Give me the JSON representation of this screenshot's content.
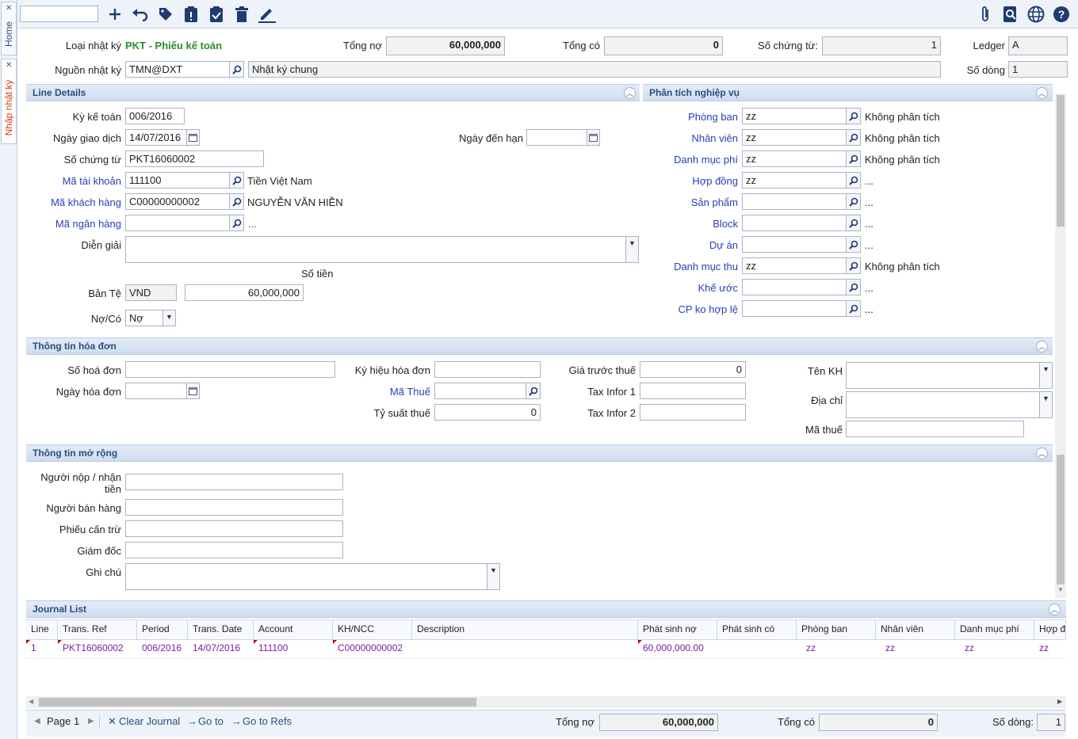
{
  "side_tabs": {
    "home": "Home",
    "journal_entry": "Nhập nhật ký"
  },
  "header": {
    "journal_type_label": "Loại nhật ký",
    "journal_type_value": "PKT - Phiếu kế toán",
    "total_debit_label": "Tổng nợ",
    "total_debit_value": "60,000,000",
    "total_credit_label": "Tổng có",
    "total_credit_value": "0",
    "voucher_no_label": "Số chứng từ:",
    "voucher_no_value": "1",
    "ledger_label": "Ledger",
    "ledger_value": "A",
    "source_label": "Nguồn nhật ký",
    "source_value": "TMN@DXT",
    "source_desc": "Nhật ký chung",
    "line_count_label": "Số dòng",
    "line_count_value": "1"
  },
  "line_details": {
    "title": "Line Details",
    "period_label": "Kỳ kế toán",
    "period_value": "006/2016",
    "trans_date_label": "Ngày giao dịch",
    "trans_date_value": "14/07/2016",
    "due_date_label": "Ngày đến hạn",
    "due_date_value": "",
    "voucher_label": "Số chứng từ",
    "voucher_value": "PKT16060002",
    "account_label": "Mã tài khoản",
    "account_value": "111100",
    "account_desc": "Tiền Việt Nam",
    "customer_label": "Mã khách hàng",
    "customer_value": "C00000000002",
    "customer_desc": "NGUYỄN VĂN HIỀN",
    "bank_label": "Mã ngân hàng",
    "bank_value": "",
    "bank_desc": "...",
    "description_label": "Diễn giải",
    "description_value": "",
    "amount_header": "Số tiền",
    "base_currency_label": "Bản Tệ",
    "currency_value": "VND",
    "amount_value": "60,000,000",
    "dc_label": "Nợ/Có",
    "dc_value": "Nợ"
  },
  "analysis": {
    "title": "Phân tích nghiệp vụ",
    "rows": [
      {
        "label": "Phòng ban",
        "value": "zz",
        "desc": "Không phân tích"
      },
      {
        "label": "Nhân viên",
        "value": "zz",
        "desc": "Không phân tích"
      },
      {
        "label": "Danh mục phí",
        "value": "zz",
        "desc": "Không phân tích"
      },
      {
        "label": "Hợp đồng",
        "value": "zz",
        "desc": "..."
      },
      {
        "label": "Sản phẩm",
        "value": "",
        "desc": "..."
      },
      {
        "label": "Block",
        "value": "",
        "desc": "..."
      },
      {
        "label": "Dự án",
        "value": "",
        "desc": "..."
      },
      {
        "label": "Danh mục thu",
        "value": "zz",
        "desc": "Không phân tích"
      },
      {
        "label": "Khế ước",
        "value": "",
        "desc": "..."
      },
      {
        "label": "CP ko hợp lệ",
        "value": "",
        "desc": "..."
      }
    ]
  },
  "invoice": {
    "title": "Thông tin hóa đơn",
    "invoice_no_label": "Số hoá đơn",
    "invoice_no_value": "",
    "invoice_date_label": "Ngày hóa đơn",
    "invoice_date_value": "",
    "symbol_label": "Ký hiệu hóa đơn",
    "symbol_value": "",
    "tax_code_label": "Mã Thuế",
    "tax_code_value": "",
    "tax_rate_label": "Tỷ suất thuế",
    "tax_rate_value": "0",
    "pretax_label": "Giá trước thuế",
    "pretax_value": "0",
    "tax_info1_label": "Tax Infor 1",
    "tax_info1_value": "",
    "tax_info2_label": "Tax Infor 2",
    "tax_info2_value": "",
    "customer_name_label": "Tên KH",
    "customer_name_value": "",
    "address_label": "Địa chỉ",
    "address_value": "",
    "tax_id_label": "Mã thuế",
    "tax_id_value": ""
  },
  "extended": {
    "title": "Thông tin mở rộng",
    "payer_label_1": "Người nộp / nhận",
    "payer_label_2": "tiền",
    "payer_value": "",
    "seller_label": "Người bán hàng",
    "seller_value": "",
    "offset_label": "Phiếu cấn trừ",
    "offset_value": "",
    "director_label": "Giám đốc",
    "director_value": "",
    "note_label": "Ghi chú",
    "note_value": ""
  },
  "journal_list": {
    "title": "Journal List",
    "columns": [
      "Line",
      "Trans. Ref",
      "Period",
      "Trans. Date",
      "Account",
      "KH/NCC",
      "Description",
      "Phát sinh nợ",
      "Phát sinh có",
      "Phòng ban",
      "Nhân viên",
      "Danh mục phí",
      "Hợp đ"
    ],
    "rows": [
      [
        "1",
        "PKT16060002",
        "006/2016",
        "14/07/2016",
        "111100",
        "C00000000002",
        "",
        "60,000,000.00",
        "",
        "zz",
        "zz",
        "zz",
        "zz"
      ]
    ]
  },
  "footer": {
    "page_label": "Page 1",
    "clear_journal": "Clear Journal",
    "go_to": "Go to",
    "go_to_refs": "Go to Refs",
    "total_debit_label": "Tổng nợ",
    "total_debit_value": "60,000,000",
    "total_credit_label": "Tổng có",
    "total_credit_value": "0",
    "line_count_label": "Số dòng:",
    "line_count_value": "1"
  },
  "colors": {
    "accent": "#2b4d80",
    "link": "#2940b8",
    "brand_green": "#2e8b2e",
    "grid_text": "#7a1fa2",
    "icon": "#1f3b70"
  }
}
